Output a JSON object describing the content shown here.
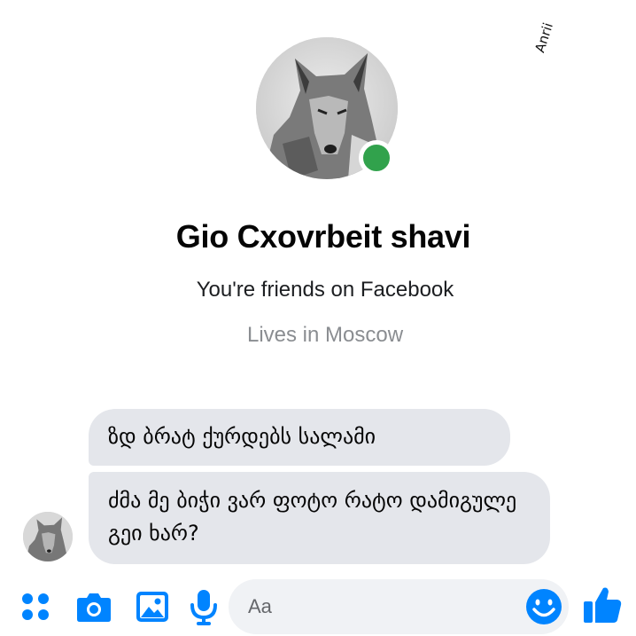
{
  "watermark": {
    "text": "Anrii"
  },
  "profile": {
    "name": "Gio Cxovrbeit shavi",
    "friends_text": "You're friends on Facebook",
    "location_text": "Lives in Moscow",
    "online": true
  },
  "messages": [
    {
      "sender": "them",
      "text": "ზდ ბრატ ქურდებს სალამი"
    },
    {
      "sender": "them",
      "text": "ძმა მე ბიჭი ვარ ფოტო რატო დამიგულე გეი ხარ?"
    }
  ],
  "composer": {
    "placeholder": "Aa",
    "icons": [
      "menu-dots-icon",
      "camera-icon",
      "photo-icon",
      "microphone-icon",
      "emoji-icon",
      "like-icon"
    ]
  },
  "colors": {
    "accent": "#0084ff",
    "online": "#31a24c",
    "bubble": "#e4e6eb",
    "input_bg": "#f0f2f5",
    "secondary_text": "#8a8d91"
  }
}
